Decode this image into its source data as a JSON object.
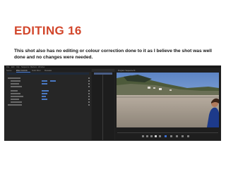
{
  "slide": {
    "title": "EDITING 16",
    "body": "This shot also has no editing or colour correction done to it as I believe the shot was well done and no changes were needed."
  },
  "colors": {
    "title": "#d2462b",
    "text": "#111111",
    "app_bg": "#232323",
    "accent_blue": "#4a79c4",
    "timecode": "#d6b13a"
  },
  "app": {
    "menu": [
      "File",
      "Edit",
      "Clip",
      "Sequence",
      "Markers",
      "Window"
    ],
    "left_tabs": [
      "Source",
      "Effect Controls",
      "Audio Mixer",
      "Metadata"
    ],
    "program_tab": "Program: Sequence 01",
    "icons": [
      "play-icon",
      "step-back-icon",
      "step-forward-icon",
      "mark-in-icon",
      "mark-out-icon",
      "export-frame-icon"
    ]
  }
}
